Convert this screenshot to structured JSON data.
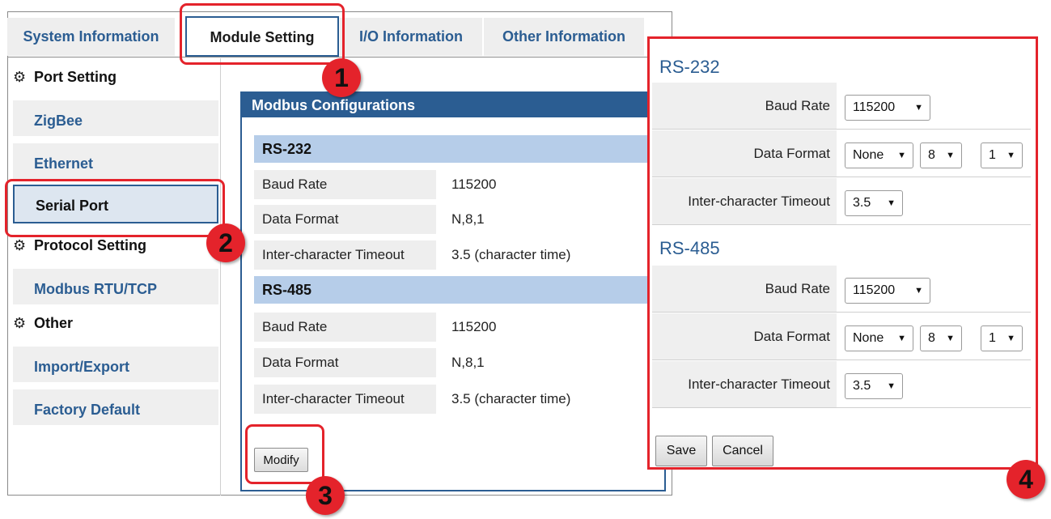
{
  "tabs": [
    {
      "label": "System Information",
      "active": false
    },
    {
      "label": "Module Setting",
      "active": true
    },
    {
      "label": "I/O Information",
      "active": false
    },
    {
      "label": "Other Information",
      "active": false
    }
  ],
  "sidebar": {
    "sections": [
      {
        "title": "Port Setting",
        "icon": "gear-icon"
      },
      {
        "title": "Protocol Setting",
        "icon": "gear-icon"
      },
      {
        "title": "Other",
        "icon": "gear-icon"
      }
    ],
    "items": [
      {
        "label": "ZigBee"
      },
      {
        "label": "Ethernet"
      },
      {
        "label": "Serial Port",
        "active": true
      },
      {
        "label": "Modbus RTU/TCP"
      },
      {
        "label": "Import/Export"
      },
      {
        "label": "Factory Default"
      }
    ]
  },
  "panel": {
    "title": "Modbus Configurations",
    "rs232": {
      "heading": "RS-232",
      "rows": [
        {
          "label": "Baud Rate",
          "value": "115200"
        },
        {
          "label": "Data Format",
          "value": "N,8,1"
        },
        {
          "label": "Inter-character Timeout",
          "value": "3.5 (character time)"
        }
      ]
    },
    "rs485": {
      "heading": "RS-485",
      "rows": [
        {
          "label": "Baud Rate",
          "value": "115200"
        },
        {
          "label": "Data Format",
          "value": "N,8,1"
        },
        {
          "label": "Inter-character Timeout",
          "value": "3.5 (character time)"
        }
      ]
    },
    "modify_label": "Modify"
  },
  "form": {
    "rs232": {
      "heading": "RS-232",
      "baud_label": "Baud Rate",
      "baud_value": "115200",
      "format_label": "Data Format",
      "parity_value": "None",
      "databits_value": "8",
      "stopbits_value": "1",
      "timeout_label": "Inter-character Timeout",
      "timeout_value": "3.5"
    },
    "rs485": {
      "heading": "RS-485",
      "baud_label": "Baud Rate",
      "baud_value": "115200",
      "format_label": "Data Format",
      "parity_value": "None",
      "databits_value": "8",
      "stopbits_value": "1",
      "timeout_label": "Inter-character Timeout",
      "timeout_value": "3.5"
    },
    "save_label": "Save",
    "cancel_label": "Cancel",
    "dropdown_arrow": "▼"
  },
  "annotations": {
    "badges": [
      "1",
      "2",
      "3",
      "4"
    ],
    "color": "#e4232b"
  },
  "colors": {
    "accent": "#2b5d92",
    "section_fill": "#b6cde9",
    "highlight": "#e4232b"
  }
}
